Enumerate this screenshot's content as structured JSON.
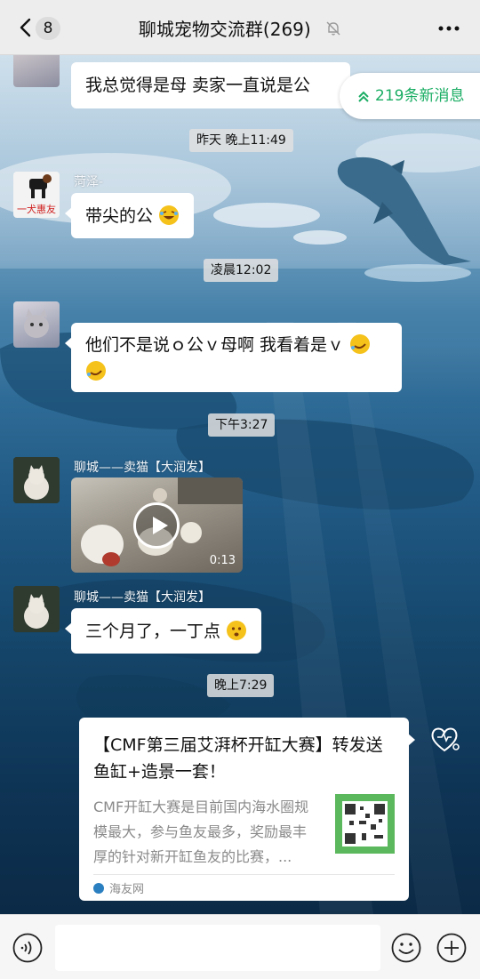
{
  "header": {
    "unread_count": "8",
    "title": "聊城宠物交流群(269)"
  },
  "new_messages": {
    "label": "219条新消息"
  },
  "messages": [
    {
      "text": "我总觉得是母  卖家一直说是公"
    },
    {
      "time": "昨天 晚上11:49"
    },
    {
      "sender": "菏泽-",
      "avatar_caption": "一犬惠友",
      "text": "带尖的公"
    },
    {
      "time": "凌晨12:02"
    },
    {
      "text": "他们不是说ｏ公ｖ母啊  我看着是ｖ"
    },
    {
      "time": "下午3:27"
    },
    {
      "sender": "聊城——卖猫【大润发】",
      "video_duration": "0:13"
    },
    {
      "sender": "聊城——卖猫【大润发】",
      "text": "三个月了，一丁点"
    },
    {
      "time": "晚上7:29"
    }
  ],
  "link_card": {
    "title": "【CMF第三届艾湃杯开缸大赛】转发送鱼缸+造景一套！",
    "description": "CMF开缸大赛是目前国内海水圈规模最大，参与鱼友最多，奖励最丰厚的针对新开缸鱼友的比赛，...",
    "source": "海友网"
  },
  "colors": {
    "accent_green": "#1aad63",
    "header_bg": "#ededed"
  }
}
